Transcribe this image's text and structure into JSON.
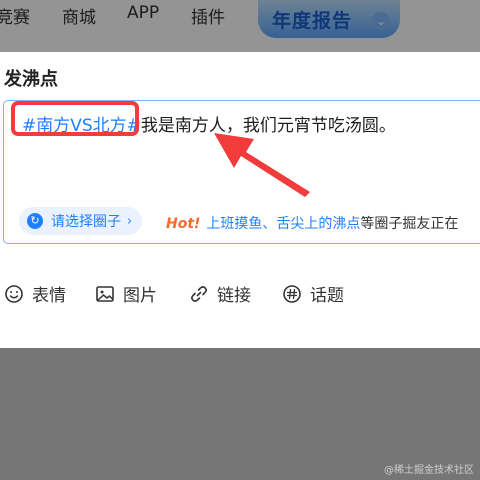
{
  "nav": {
    "items": [
      "竞赛",
      "商城",
      "APP",
      "插件"
    ],
    "banner_text": "年度报告",
    "banner_icon": "chevron-double-down-icon"
  },
  "dialog": {
    "title": "发沸点",
    "editor": {
      "topic_tag": "#南方VS北方#",
      "body_text": "我是南方人，我们元宵节吃汤圆。"
    },
    "circle_selector": {
      "label": "请选择圈子",
      "arrow": "›"
    },
    "hot": {
      "label": "Hot!",
      "link1": "上班摸鱼",
      "separator": "、",
      "link2": "舌尖上的沸点",
      "rest": "等圈子掘友正在"
    },
    "toolbar": {
      "emoji_label": "表情",
      "image_label": "图片",
      "link_label": "链接",
      "topic_label": "话题"
    }
  },
  "colors": {
    "accent": "#1e80ff",
    "annotation": "#f23b3b",
    "hot": "#f56a2f"
  },
  "watermark": "@稀土掘金技术社区"
}
